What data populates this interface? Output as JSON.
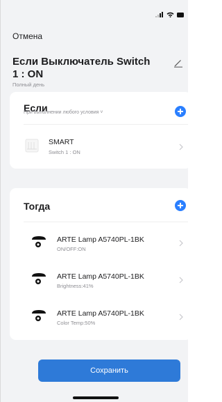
{
  "header": {
    "cancel_label": "Отмена",
    "title": "Если Выключатель Switch 1 : ON",
    "subtitle": "Полный день"
  },
  "if_section": {
    "title": "Если",
    "subtitle": "При выполнении любого условия ˅",
    "conditions": [
      {
        "title": "SMART",
        "detail": "Switch 1 : ON",
        "icon": "smart-switch-icon"
      }
    ]
  },
  "then_section": {
    "title": "Тогда",
    "actions": [
      {
        "title": "ARTE Lamp A5740PL-1BK",
        "detail": "ON/OFF:ON",
        "icon": "lamp-icon"
      },
      {
        "title": "ARTE Lamp A5740PL-1BK",
        "detail": "Brightness:41%",
        "icon": "lamp-icon"
      },
      {
        "title": "ARTE Lamp A5740PL-1BK",
        "detail": "Color Temp:50%",
        "icon": "lamp-icon"
      }
    ]
  },
  "footer": {
    "save_label": "Сохранить"
  },
  "colors": {
    "accent": "#2a7fff",
    "save_button": "#2e7ad8",
    "background": "#f2f3f5"
  }
}
